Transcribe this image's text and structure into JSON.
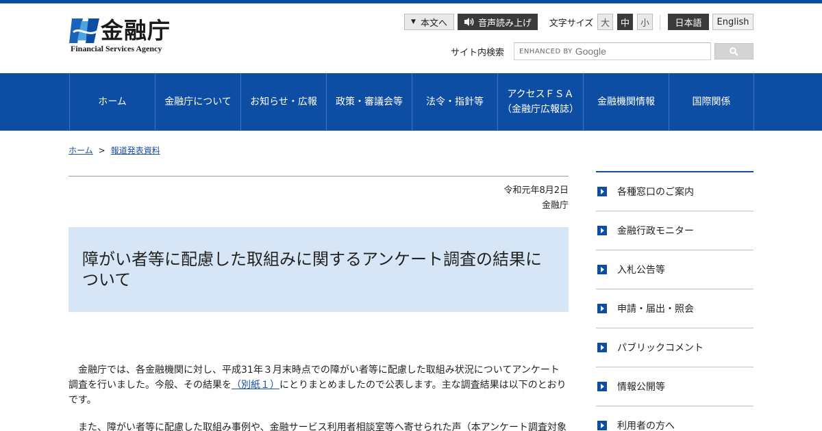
{
  "header": {
    "logo_text": "金融庁",
    "logo_sub": "Financial Services Agency",
    "skip_label": "本文へ",
    "voice_label": "音声読み上げ",
    "font_size_label": "文字サイズ",
    "font_size_large": "大",
    "font_size_medium": "中",
    "font_size_small": "小",
    "lang_ja": "日本語",
    "lang_en": "English",
    "search_label": "サイト内検索",
    "search_enhanced": "ENHANCED BY",
    "search_brand": "Google"
  },
  "nav": {
    "items": [
      {
        "label": "ホーム"
      },
      {
        "label": "金融庁について"
      },
      {
        "label": "お知らせ・広報"
      },
      {
        "label": "政策・審議会等"
      },
      {
        "label": "法令・指針等"
      },
      {
        "label": "アクセスＦＳＡ",
        "label2": "（金融庁広報誌）"
      },
      {
        "label": "金融機関情報"
      },
      {
        "label": "国際関係"
      }
    ]
  },
  "breadcrumb": {
    "home": "ホーム",
    "separator": ">",
    "current": "報道発表資料"
  },
  "article": {
    "date": "令和元年8月2日",
    "issuer": "金融庁",
    "title": "障がい者等に配慮した取組みに関するアンケート調査の結果について",
    "para1_a": "金融庁では、各金融機関に対し、平成31年３月末時点での障がい者等に配慮した取組み状況についてアンケート調査を行いました。今般、その結果を",
    "para1_link": "（別紙１）",
    "para1_b": "にとりまとめましたので公表します。主な調査結果は以下のとおりです。",
    "para2": "また、障がい者等に配慮した取組み事例や、金融サービス利用者相談室等へ寄せられた声（本アンケート調査対象"
  },
  "sidebar": {
    "items": [
      {
        "label": "各種窓口のご案内"
      },
      {
        "label": "金融行政モニター"
      },
      {
        "label": "入札公告等"
      },
      {
        "label": "申請・届出・照会"
      },
      {
        "label": "パブリックコメント"
      },
      {
        "label": "情報公開等"
      },
      {
        "label": "利用者の方へ"
      }
    ]
  },
  "colors": {
    "brand_blue": "#0e4da4",
    "title_bg": "#d7e6f6",
    "link": "#1a4fa0"
  }
}
